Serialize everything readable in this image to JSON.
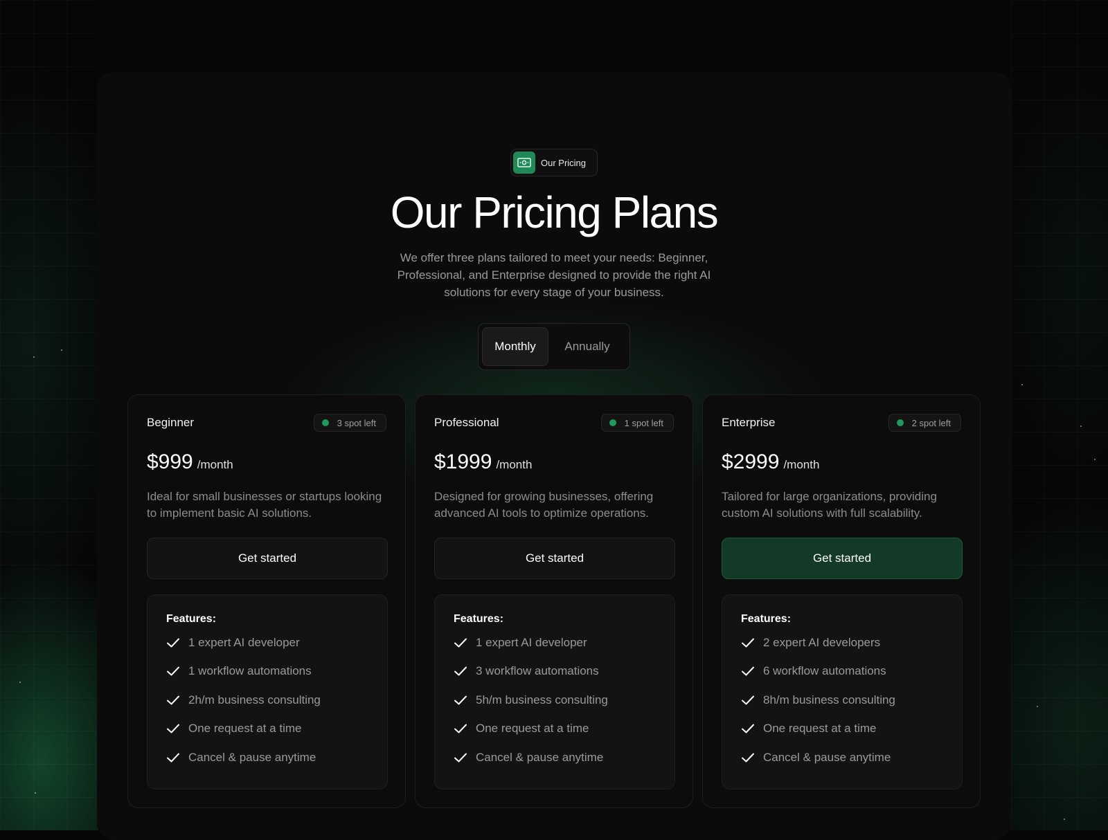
{
  "badge": {
    "label": "Our Pricing",
    "icon": "banknote-icon",
    "color": "#1f8a58"
  },
  "header": {
    "title": "Our Pricing Plans",
    "subtitle": "We offer three plans tailored to meet your needs: Beginner, Professional, and Enterprise designed to provide the right AI solutions for every stage of your business."
  },
  "billing_toggle": {
    "options": [
      "Monthly",
      "Annually"
    ],
    "selected": "Monthly"
  },
  "colors": {
    "accent": "#1f9a5e",
    "primary_button": "#133a27",
    "background": "#060606"
  },
  "plans": [
    {
      "name": "Beginner",
      "spots": "3 spot left",
      "price": "$999",
      "period": "/month",
      "description": "Ideal for small businesses or startups looking to implement basic AI solutions.",
      "cta": "Get started",
      "features_title": "Features:",
      "features": [
        "1 expert AI developer",
        "1 workflow automations",
        "2h/m business consulting",
        "One request at a time",
        "Cancel & pause anytime"
      ]
    },
    {
      "name": "Professional",
      "spots": "1 spot left",
      "price": "$1999",
      "period": "/month",
      "description": "Designed for growing businesses, offering advanced AI tools to optimize operations.",
      "cta": "Get started",
      "features_title": "Features:",
      "features": [
        "1 expert AI developer",
        "3 workflow automations",
        "5h/m business consulting",
        "One request at a time",
        "Cancel & pause anytime"
      ]
    },
    {
      "name": "Enterprise",
      "spots": "2 spot left",
      "price": "$2999",
      "period": "/month",
      "description": "Tailored for large organizations, providing custom AI solutions with full scalability.",
      "cta": "Get started",
      "features_title": "Features:",
      "features": [
        "2 expert AI developers",
        "6 workflow automations",
        "8h/m business consulting",
        "One request at a time",
        "Cancel & pause anytime"
      ]
    }
  ]
}
